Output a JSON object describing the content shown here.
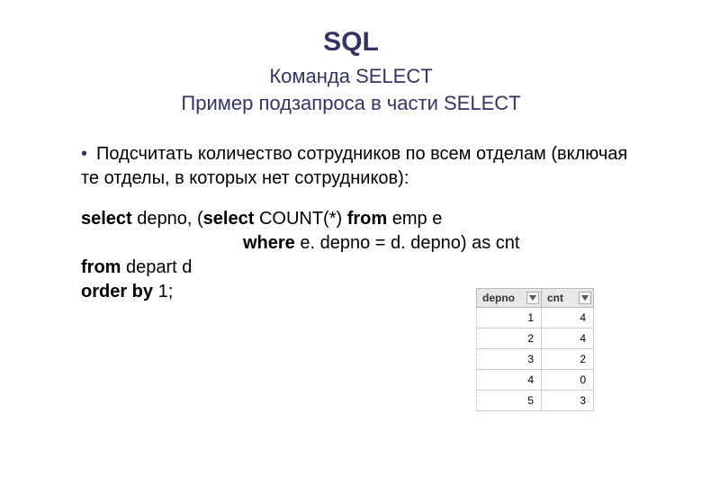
{
  "title": "SQL",
  "subtitle1": "Команда SELECT",
  "subtitle2": "Пример подзапроса в части SELECT",
  "bullet": {
    "marker": "•",
    "text": "Подсчитать количество сотрудников по всем отделам (включая те отделы, в которых нет сотрудников):"
  },
  "sql": {
    "kw_select": "select",
    "line1_rest": " depno, (",
    "kw_select2": "select",
    "line1_mid": " COUNT(*) ",
    "kw_from1": "from",
    "line1_end": " emp e",
    "kw_where": "where",
    "line2_rest": " e. depno = d. depno) as cnt",
    "kw_from2": "from",
    "line3_rest": " depart d",
    "kw_orderby": "order by",
    "line4_rest": " 1;"
  },
  "chart_data": {
    "type": "table",
    "columns": [
      "depno",
      "cnt"
    ],
    "rows": [
      {
        "depno": 1,
        "cnt": 4
      },
      {
        "depno": 2,
        "cnt": 4
      },
      {
        "depno": 3,
        "cnt": 2
      },
      {
        "depno": 4,
        "cnt": 0
      },
      {
        "depno": 5,
        "cnt": 3
      }
    ]
  }
}
